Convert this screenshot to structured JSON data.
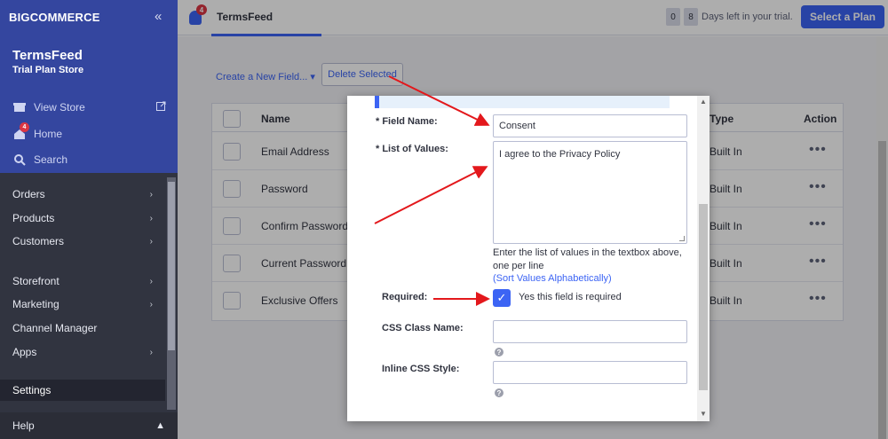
{
  "sidebar": {
    "logo": "BIGCOMMERCE",
    "store_name": "TermsFeed",
    "store_plan": "Trial Plan Store",
    "view_store": "View Store",
    "home": "Home",
    "home_badge": "4",
    "search": "Search",
    "nav": [
      "Orders",
      "Products",
      "Customers",
      "Storefront",
      "Marketing",
      "Channel Manager",
      "Apps",
      "Settings"
    ],
    "help": "Help"
  },
  "topbar": {
    "notification_count": "4",
    "store_name": "TermsFeed",
    "trial_digit_1": "0",
    "trial_digit_2": "8",
    "trial_text": "Days left in your trial.",
    "select_plan": "Select a Plan"
  },
  "main": {
    "create_link": "Create a New Field...",
    "delete_button": "Delete Selected",
    "table": {
      "header_name": "Name",
      "header_type": "Type",
      "header_action": "Action",
      "rows": [
        {
          "name": "Email Address",
          "type": "Built In"
        },
        {
          "name": "Password",
          "type": "Built In"
        },
        {
          "name": "Confirm Password",
          "type": "Built In"
        },
        {
          "name": "Current Password",
          "type": "Built In"
        },
        {
          "name": "Exclusive Offers",
          "type": "Built In"
        }
      ]
    }
  },
  "modal": {
    "field_name_label": "* Field Name:",
    "field_name_value": "Consent",
    "list_values_label": "* List of Values:",
    "list_values_value": "I agree to the Privacy Policy",
    "list_help": "Enter the list of values in the textbox above, one per line",
    "sort_link": "(Sort Values Alphabetically)",
    "required_label": "Required:",
    "required_text": "Yes this field is required",
    "css_class_label": "CSS Class Name:",
    "css_class_value": "",
    "inline_css_label": "Inline CSS Style:",
    "inline_css_value": ""
  },
  "colors": {
    "brand_blue": "#3c64f4",
    "sidebar_top": "#34469f",
    "sidebar_dark": "#313440",
    "annotation_arrow": "#e3181c"
  }
}
